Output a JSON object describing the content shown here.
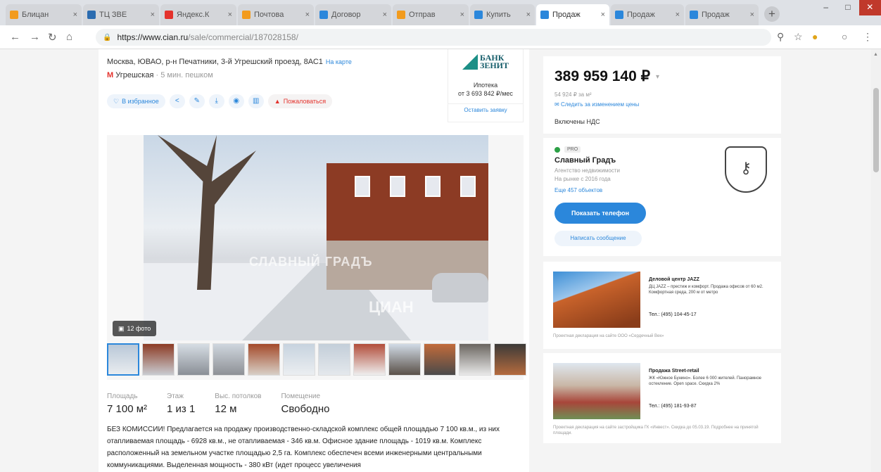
{
  "tabs": [
    {
      "title": "Блицан",
      "color": "#f29b1d"
    },
    {
      "title": "ТЦ ЗВЕ",
      "color": "#2b6cb0"
    },
    {
      "title": "Яндекс.К",
      "color": "#e4322c"
    },
    {
      "title": "Почтова",
      "color": "#f29b1d"
    },
    {
      "title": "Договор",
      "color": "#2b87db"
    },
    {
      "title": "Отправ",
      "color": "#f29b1d"
    },
    {
      "title": "Купить",
      "color": "#2b87db"
    },
    {
      "title": "Продаж",
      "color": "#2b87db",
      "active": true
    },
    {
      "title": "Продаж",
      "color": "#2b87db"
    },
    {
      "title": "Продаж",
      "color": "#2b87db"
    }
  ],
  "browser": {
    "url_host": "https://www.cian.ru",
    "url_path": "/sale/commercial/187028158/"
  },
  "listing": {
    "address": "Москва, ЮВАО, р-н Печатники, 3-й Угрешский проезд, 8АС1",
    "map_link": "На карте",
    "metro": "Угрешская",
    "walk": "· 5 мин. пешком",
    "favorite": "В избранное",
    "complain": "Пожаловаться",
    "photo_count": "12 фото",
    "watermark_agency": "СЛАВНЫЙ ГРАДЪ",
    "watermark_site": "ЦИАН",
    "params": [
      {
        "label": "Площадь",
        "value": "7 100 м²"
      },
      {
        "label": "Этаж",
        "value": "1 из 1"
      },
      {
        "label": "Выс. потолков",
        "value": "12 м"
      },
      {
        "label": "Помещение",
        "value": "Свободно"
      }
    ],
    "description": "БЕЗ КОМИССИИ! Предлагается на продажу производственно-складской комплекс общей площадью 7 100 кв.м., из них отапливаемая площадь - 6928 кв.м., не отапливаемая - 346 кв.м. Офисное здание площадь - 1019 кв.м. Комплекс расположенный на земельном участке площадью 2,5 га. Комплекс обеспечен всеми инженерными центральными коммуникациями. Выделенная мощность - 380 кВт (идет процесс увеличения"
  },
  "bank": {
    "name_line1": "БАНК",
    "name_line2": "ЗЕНИТ",
    "mortgage": "Ипотека",
    "mortgage_amount": "от 3 693 842 ₽/мес",
    "request": "Оставить заявку"
  },
  "price_block": {
    "price": "389 959 140 ₽",
    "per_meter": "54 924 ₽ за м²",
    "follow": "Следить за изменением цены",
    "vat": "Включены НДС"
  },
  "agent": {
    "badge": "PRO",
    "name": "Славный Градъ",
    "type": "Агентство недвижимости",
    "since": "На рынке с 2016 года",
    "objects": "Еще 457 объектов",
    "phone_btn": "Показать телефон",
    "msg_btn": "Написать сообщение"
  },
  "ads": [
    {
      "title": "Деловой центр JAZZ",
      "text": "ДЦ JAZZ – престиж и комфорт. Продажа офисов от 60 м2. Комфортная среда, 200 м от метро",
      "tel": "Тел.: (495) 104-45-17",
      "note": "Проектная декларация на сайте ООО «Сердечный Век»"
    },
    {
      "title": "Продажа Street-retail",
      "text": "ЖК «Южное Бунино». Более 6 000 жителей. Панорамное остекление. Open space. Скидка 2%",
      "tel": "Тел.: (495) 181-93-87",
      "note": "Проектная декларация на сайте застройщика ГК «Инвест». Скидка до 05.03.19. Подробнее на принятой площади."
    }
  ]
}
